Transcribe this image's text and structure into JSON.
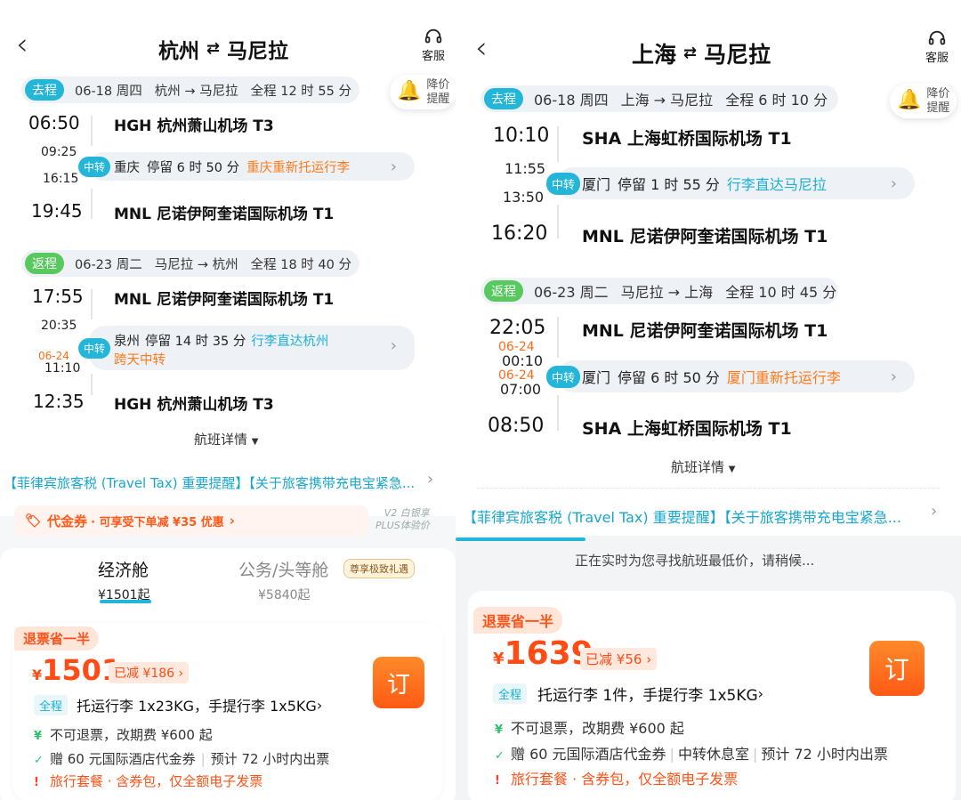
{
  "left": {
    "header": {
      "from": "杭州",
      "to": "马尼拉",
      "service": "客服"
    },
    "alert": {
      "line1": "降价",
      "line2": "提醒"
    },
    "outbound": {
      "tag": "去程",
      "date": "06-18 周四",
      "route": "杭州 → 马尼拉",
      "total": "全程 12 时 55 分",
      "dep_time": "06:50",
      "dep_airport": "HGH 杭州萧山机场 T3",
      "stop_arr": "09:25",
      "stop_dep": "16:15",
      "transfer_tag": "中转",
      "stop_city": "重庆",
      "stop_duration": "停留 6 时 50 分",
      "stop_note": "重庆重新托运行李",
      "arr_time": "19:45",
      "arr_airport": "MNL 尼诺伊阿奎诺国际机场 T1"
    },
    "inbound": {
      "tag": "返程",
      "date": "06-23 周二",
      "route": "马尼拉 → 杭州",
      "total": "全程 18 时 40 分",
      "dep_time": "17:55",
      "dep_airport": "MNL 尼诺伊阿奎诺国际机场 T1",
      "stop_arr": "20:35",
      "stop_dep_date": "06-24",
      "stop_dep": "11:10",
      "transfer_tag": "中转",
      "stop_city": "泉州",
      "stop_duration": "停留 14 时 35 分",
      "stop_note": "行李直达杭州",
      "stop_note2": "跨天中转",
      "arr_time": "12:35",
      "arr_airport": "HGH 杭州萧山机场 T3"
    },
    "details": "航班详情",
    "notice": "【菲律宾旅客税 (Travel Tax) 重要提醒】【关于旅客携带充电宝紧急...",
    "coupon": {
      "name": "代金券",
      "desc": "· 可享受下单减 ¥35 优惠",
      "plus1": "V2 白银享",
      "plus2": "PLUS体验价"
    },
    "cabins": {
      "eco": "经济舱",
      "eco_price": "¥1501起",
      "biz": "公务/头等舱",
      "biz_price": "¥5840起",
      "honor": "尊享极致礼遇"
    },
    "offer": {
      "badge": "退票省一半",
      "currency": "¥",
      "price": "1501",
      "reduced": "已减",
      "reduced_amt": "¥186",
      "book": "订",
      "qc": "全程",
      "bags": "托运行李 1x23KG，手提行李 1x5KG",
      "refund": "不可退票，改期费 ¥600 起",
      "gift": "赠 60 元国际酒店代金券",
      "gift_sep": "预计 72 小时内出票",
      "pkg": "旅行套餐 · 含券包，仅全额电子发票"
    }
  },
  "right": {
    "header": {
      "from": "上海",
      "to": "马尼拉",
      "service": "客服"
    },
    "alert": {
      "line1": "降价",
      "line2": "提醒"
    },
    "outbound": {
      "tag": "去程",
      "date": "06-18 周四",
      "route": "上海 → 马尼拉",
      "total": "全程 6 时 10 分",
      "dep_time": "10:10",
      "dep_airport": "SHA 上海虹桥国际机场 T1",
      "stop_arr": "11:55",
      "stop_dep": "13:50",
      "transfer_tag": "中转",
      "stop_city": "厦门",
      "stop_duration": "停留 1 时 55 分",
      "stop_note": "行李直达马尼拉",
      "arr_time": "16:20",
      "arr_airport": "MNL 尼诺伊阿奎诺国际机场 T1"
    },
    "inbound": {
      "tag": "返程",
      "date": "06-23 周二",
      "route": "马尼拉 → 上海",
      "total": "全程 10 时 45 分",
      "dep_time": "22:05",
      "dep_airport": "MNL 尼诺伊阿奎诺国际机场 T1",
      "stop_arr_date": "06-24",
      "stop_arr": "00:10",
      "stop_dep_date": "06-24",
      "stop_dep": "07:00",
      "transfer_tag": "中转",
      "stop_city": "厦门",
      "stop_duration": "停留 6 时 50 分",
      "stop_note": "厦门重新托运行李",
      "arr_time": "08:50",
      "arr_airport": "SHA 上海虹桥国际机场 T1"
    },
    "details": "航班详情",
    "notice": "【菲律宾旅客税 (Travel Tax) 重要提醒】【关于旅客携带充电宝紧急...",
    "loading": "正在实时为您寻找航班最低价，请稍候...",
    "offer": {
      "badge": "退票省一半",
      "currency": "¥",
      "price": "1639",
      "reduced": "已减",
      "reduced_amt": "¥56",
      "book": "订",
      "qc": "全程",
      "bags": "托运行李 1件，手提行李 1x5KG",
      "refund": "不可退票，改期费 ¥600 起",
      "gift": "赠 60 元国际酒店代金券",
      "gift_mid": "中转休息室",
      "gift_sep": "预计 72 小时内出票",
      "pkg": "旅行套餐 · 含券包，仅全额电子发票"
    }
  }
}
